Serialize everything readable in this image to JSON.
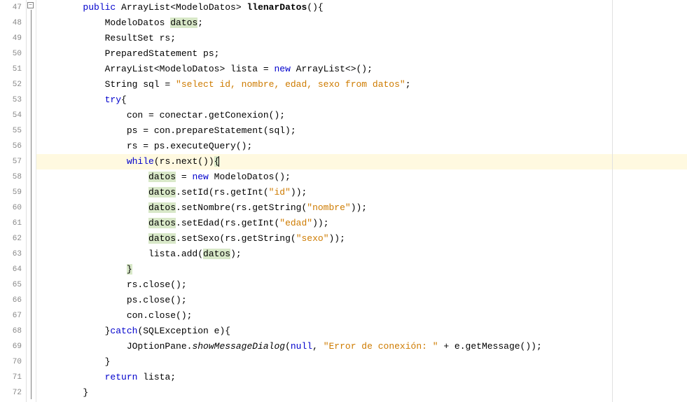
{
  "lineStart": 47,
  "lineEnd": 72,
  "highlightedLine": 57,
  "tokens": {
    "l47": [
      {
        "t": "        ",
        "c": ""
      },
      {
        "t": "public",
        "c": "kw"
      },
      {
        "t": " ArrayList<ModeloDatos> ",
        "c": ""
      },
      {
        "t": "llenarDatos",
        "c": "bold"
      },
      {
        "t": "(){",
        "c": ""
      }
    ],
    "l48": [
      {
        "t": "            ModeloDatos ",
        "c": ""
      },
      {
        "t": "datos",
        "c": "hlvar"
      },
      {
        "t": ";",
        "c": ""
      }
    ],
    "l49": [
      {
        "t": "            ResultSet rs;",
        "c": ""
      }
    ],
    "l50": [
      {
        "t": "            PreparedStatement ps;",
        "c": ""
      }
    ],
    "l51": [
      {
        "t": "            ArrayList<ModeloDatos> lista = ",
        "c": ""
      },
      {
        "t": "new",
        "c": "kw"
      },
      {
        "t": " ArrayList<>();",
        "c": ""
      }
    ],
    "l52": [
      {
        "t": "            String sql = ",
        "c": ""
      },
      {
        "t": "\"select id, nombre, edad, sexo from datos\"",
        "c": "str"
      },
      {
        "t": ";",
        "c": ""
      }
    ],
    "l53": [
      {
        "t": "            ",
        "c": ""
      },
      {
        "t": "try",
        "c": "kw"
      },
      {
        "t": "{",
        "c": ""
      }
    ],
    "l54": [
      {
        "t": "                con = conectar.getConexion();",
        "c": ""
      }
    ],
    "l55": [
      {
        "t": "                ps = con.prepareStatement(sql);",
        "c": ""
      }
    ],
    "l56": [
      {
        "t": "                rs = ps.executeQuery();",
        "c": ""
      }
    ],
    "l57": [
      {
        "t": "                ",
        "c": ""
      },
      {
        "t": "while",
        "c": "kw"
      },
      {
        "t": "(rs.next())",
        "c": ""
      },
      {
        "t": "{",
        "c": "hlvar"
      }
    ],
    "l58": [
      {
        "t": "                    ",
        "c": ""
      },
      {
        "t": "datos",
        "c": "hlvar"
      },
      {
        "t": " = ",
        "c": ""
      },
      {
        "t": "new",
        "c": "kw"
      },
      {
        "t": " ModeloDatos();",
        "c": ""
      }
    ],
    "l59": [
      {
        "t": "                    ",
        "c": ""
      },
      {
        "t": "datos",
        "c": "hlvar"
      },
      {
        "t": ".setId(rs.getInt(",
        "c": ""
      },
      {
        "t": "\"id\"",
        "c": "str"
      },
      {
        "t": "));",
        "c": ""
      }
    ],
    "l60": [
      {
        "t": "                    ",
        "c": ""
      },
      {
        "t": "datos",
        "c": "hlvar"
      },
      {
        "t": ".setNombre(rs.getString(",
        "c": ""
      },
      {
        "t": "\"nombre\"",
        "c": "str"
      },
      {
        "t": "));",
        "c": ""
      }
    ],
    "l61": [
      {
        "t": "                    ",
        "c": ""
      },
      {
        "t": "datos",
        "c": "hlvar"
      },
      {
        "t": ".setEdad(rs.getInt(",
        "c": ""
      },
      {
        "t": "\"edad\"",
        "c": "str"
      },
      {
        "t": "));",
        "c": ""
      }
    ],
    "l62": [
      {
        "t": "                    ",
        "c": ""
      },
      {
        "t": "datos",
        "c": "hlvar"
      },
      {
        "t": ".setSexo(rs.getString(",
        "c": ""
      },
      {
        "t": "\"sexo\"",
        "c": "str"
      },
      {
        "t": "));",
        "c": ""
      }
    ],
    "l63": [
      {
        "t": "                    lista.add(",
        "c": ""
      },
      {
        "t": "datos",
        "c": "hlvar"
      },
      {
        "t": ");",
        "c": ""
      }
    ],
    "l64": [
      {
        "t": "                ",
        "c": ""
      },
      {
        "t": "}",
        "c": "hlvar"
      }
    ],
    "l65": [
      {
        "t": "                rs.close();",
        "c": ""
      }
    ],
    "l66": [
      {
        "t": "                ps.close();",
        "c": ""
      }
    ],
    "l67": [
      {
        "t": "                con.close();",
        "c": ""
      }
    ],
    "l68": [
      {
        "t": "            }",
        "c": ""
      },
      {
        "t": "catch",
        "c": "kw"
      },
      {
        "t": "(SQLException e){",
        "c": ""
      }
    ],
    "l69": [
      {
        "t": "                JOptionPane.",
        "c": ""
      },
      {
        "t": "showMessageDialog",
        "c": "italic"
      },
      {
        "t": "(",
        "c": ""
      },
      {
        "t": "null",
        "c": "lit"
      },
      {
        "t": ", ",
        "c": ""
      },
      {
        "t": "\"Error de conexión: \"",
        "c": "str"
      },
      {
        "t": " + e.getMessage());",
        "c": ""
      }
    ],
    "l70": [
      {
        "t": "            }",
        "c": ""
      }
    ],
    "l71": [
      {
        "t": "            ",
        "c": ""
      },
      {
        "t": "return",
        "c": "kw"
      },
      {
        "t": " lista;",
        "c": ""
      }
    ],
    "l72": [
      {
        "t": "        }",
        "c": ""
      }
    ]
  }
}
